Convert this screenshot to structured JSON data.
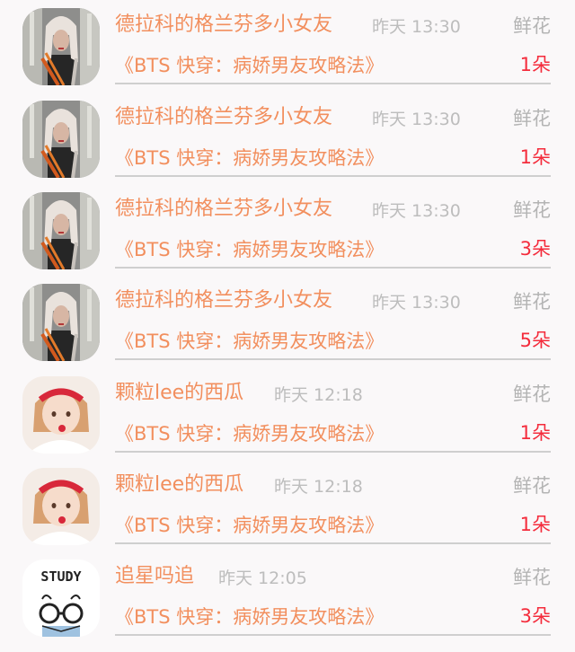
{
  "gift_list": [
    {
      "user": "德拉科的格兰芬多小女友",
      "time": "昨天 13:30",
      "gift_type": "鲜花",
      "book": "《BTS 快穿：病娇男友攻略法》",
      "count": "1朵",
      "avatar": "girl-long-braids-avatar"
    },
    {
      "user": "德拉科的格兰芬多小女友",
      "time": "昨天 13:30",
      "gift_type": "鲜花",
      "book": "《BTS 快穿：病娇男友攻略法》",
      "count": "1朵",
      "avatar": "girl-long-braids-avatar"
    },
    {
      "user": "德拉科的格兰芬多小女友",
      "time": "昨天 13:30",
      "gift_type": "鲜花",
      "book": "《BTS 快穿：病娇男友攻略法》",
      "count": "3朵",
      "avatar": "girl-long-braids-avatar"
    },
    {
      "user": "德拉科的格兰芬多小女友",
      "time": "昨天 13:30",
      "gift_type": "鲜花",
      "book": "《BTS 快穿：病娇男友攻略法》",
      "count": "5朵",
      "avatar": "girl-long-braids-avatar"
    },
    {
      "user": "颗粒lee的西瓜",
      "time": "昨天 12:18",
      "gift_type": "鲜花",
      "book": "《BTS 快穿：病娇男友攻略法》",
      "count": "1朵",
      "avatar": "girl-red-headband-avatar"
    },
    {
      "user": "颗粒lee的西瓜",
      "time": "昨天 12:18",
      "gift_type": "鲜花",
      "book": "《BTS 快穿：病娇男友攻略法》",
      "count": "1朵",
      "avatar": "girl-red-headband-avatar"
    },
    {
      "user": "追星吗追",
      "time": "昨天 12:05",
      "gift_type": "鲜花",
      "book": "《BTS 快穿：病娇男友攻略法》",
      "count": "3朵",
      "avatar": "study-cartoon-avatar",
      "avatar_text": "STUDY"
    }
  ],
  "colors": {
    "accent_orange": "#f28f5e",
    "count_red": "#f42c3c",
    "muted_gray": "#bdbdbd",
    "background": "#faf8f9"
  }
}
